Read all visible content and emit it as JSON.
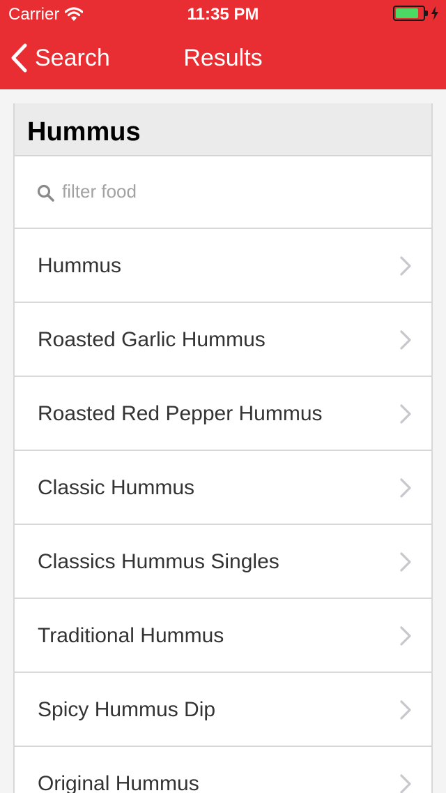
{
  "status_bar": {
    "carrier": "Carrier",
    "time": "11:35 PM",
    "battery_level": 0.85,
    "wifi_icon": "wifi-icon",
    "battery_icon": "battery-icon",
    "charging_icon": "bolt-icon"
  },
  "nav": {
    "back_label": "Search",
    "back_icon": "chevron-left-icon",
    "title": "Results"
  },
  "results": {
    "heading": "Hummus",
    "filter": {
      "placeholder": "filter food",
      "value": "",
      "icon": "search-icon"
    },
    "items": [
      {
        "label": "Hummus"
      },
      {
        "label": "Roasted Garlic Hummus"
      },
      {
        "label": "Roasted Red Pepper Hummus"
      },
      {
        "label": "Classic Hummus"
      },
      {
        "label": "Classics Hummus Singles"
      },
      {
        "label": "Traditional Hummus"
      },
      {
        "label": "Spicy Hummus Dip"
      },
      {
        "label": "Original Hummus"
      }
    ],
    "row_icon": "chevron-right-icon"
  },
  "colors": {
    "brand_red": "#e82e32",
    "battery_green": "#4cd964",
    "text_primary": "#333333",
    "placeholder": "#a2a2a2",
    "divider": "#d8d8d8",
    "header_bg": "#ebebeb",
    "page_bg": "#f4f4f4"
  }
}
